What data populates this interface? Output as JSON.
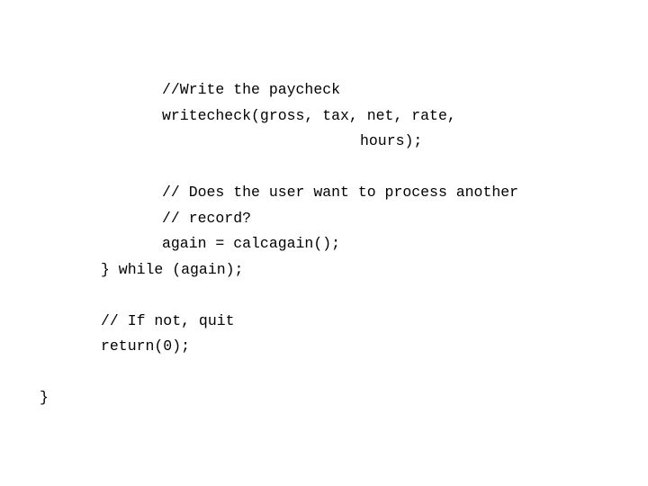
{
  "slide": {
    "background_color": "#ffffff",
    "text_color": "#000000",
    "code": {
      "group1": [
        {
          "indent": 2,
          "text": "//Write the paycheck"
        },
        {
          "indent": 2,
          "text": "writecheck(gross, tax, net, rate,"
        },
        {
          "indent": 3,
          "text": "hours);"
        }
      ],
      "group2": [
        {
          "indent": 2,
          "text": "// Does the user want to process another"
        },
        {
          "indent": 2,
          "text": "// record?"
        },
        {
          "indent": 2,
          "text": "again = calcagain();"
        },
        {
          "indent": 1,
          "text": "} while (again);"
        }
      ],
      "group3": [
        {
          "indent": 1,
          "text": "// If not, quit"
        },
        {
          "indent": 1,
          "text": "return(0);"
        },
        {
          "indent": 0,
          "text": "}"
        }
      ]
    }
  }
}
